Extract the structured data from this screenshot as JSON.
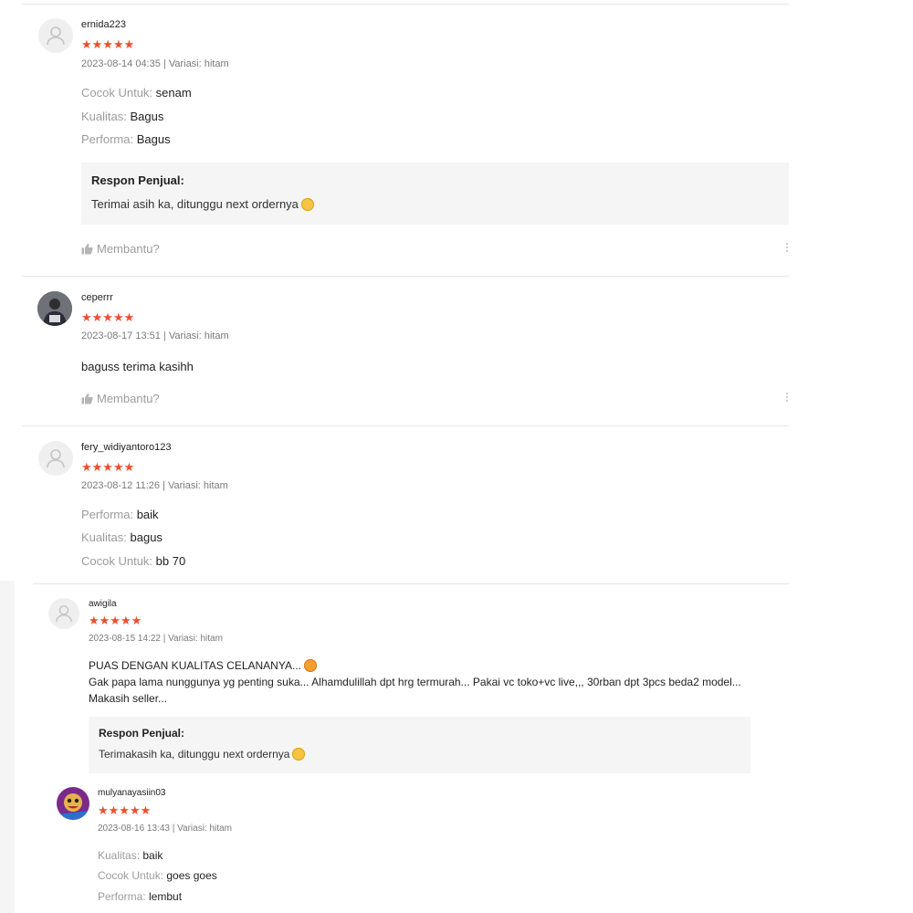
{
  "helpful_label": "Membantu?",
  "accent_color": "#ee4d2d",
  "reviews": [
    {
      "username": "ernida223",
      "rating": 5,
      "stars": "★★★★★",
      "meta": "2023-08-14 04:35 | Variasi: hitam",
      "avatar": "default-user-icon",
      "attributes": [
        {
          "label": "Cocok Untuk:",
          "value": "senam"
        },
        {
          "label": "Kualitas:",
          "value": "Bagus"
        },
        {
          "label": "Performa:",
          "value": "Bagus"
        }
      ],
      "seller_response": {
        "title": "Respon Penjual:",
        "text": "Terimai asih ka, ditunggu next ordernya"
      }
    },
    {
      "username": "ceperrr",
      "rating": 5,
      "stars": "★★★★★",
      "meta": "2023-08-17 13:51 | Variasi: hitam",
      "avatar": "photo",
      "comment": "baguss terima kasihh"
    },
    {
      "username": "fery_widiyantoro123",
      "rating": 5,
      "stars": "★★★★★",
      "meta": "2023-08-12 11:26 | Variasi: hitam",
      "avatar": "default-user-icon",
      "attributes": [
        {
          "label": "Performa:",
          "value": "baik"
        },
        {
          "label": "Kualitas:",
          "value": "bagus"
        },
        {
          "label": "Cocok Untuk:",
          "value": "bb 70"
        }
      ]
    },
    {
      "username": "awigila",
      "rating": 5,
      "stars": "★★★★★",
      "meta": "2023-08-15 14:22 | Variasi: hitam",
      "avatar": "default-user-icon",
      "comment_lines": [
        "PUAS DENGAN KUALITAS CELANANYA...",
        "Gak papa lama nunggunya yg penting suka... Alhamdulillah dpt hrg termurah... Pakai vc toko+vc live,,, 30rban dpt 3pcs beda2 model...",
        "Makasih seller..."
      ],
      "seller_response": {
        "title": "Respon Penjual:",
        "text": "Terimakasih ka, ditunggu next ordernya"
      }
    },
    {
      "username": "mulyanayasiin03",
      "rating": 5,
      "stars": "★★★★★",
      "meta": "2023-08-16 13:43 | Variasi: hitam",
      "avatar": "photo",
      "attributes": [
        {
          "label": "Kualitas:",
          "value": "baik"
        },
        {
          "label": "Cocok Untuk:",
          "value": "goes goes"
        },
        {
          "label": "Performa:",
          "value": "lembut"
        }
      ]
    }
  ]
}
